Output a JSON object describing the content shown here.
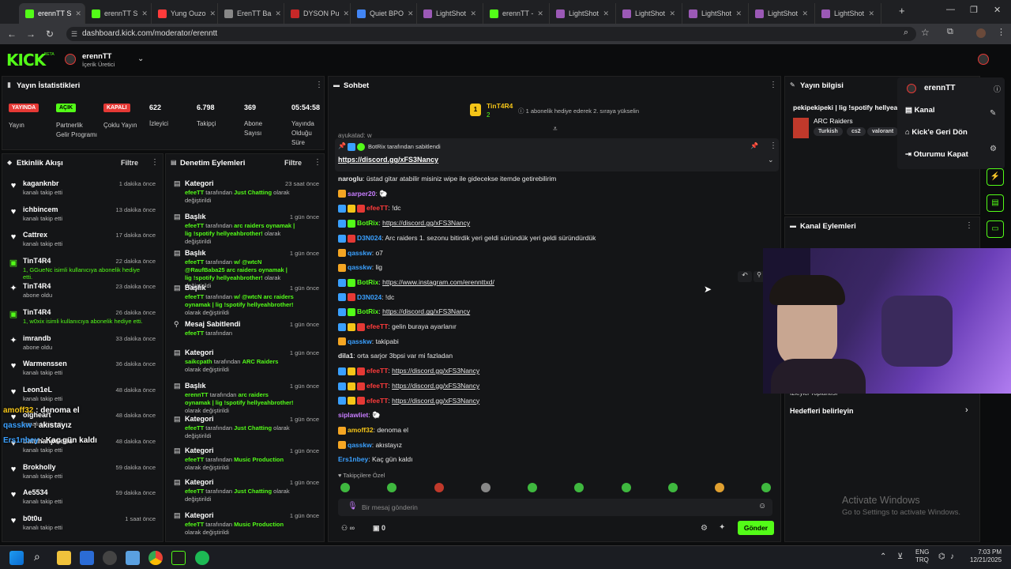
{
  "tabs": [
    {
      "label": "erennTT S",
      "color": "#53fc18",
      "active": true
    },
    {
      "label": "erennTT S",
      "color": "#53fc18"
    },
    {
      "label": "Yung Ouzo",
      "color": "#ff3b3b"
    },
    {
      "label": "ErenTT Ba",
      "color": "#888"
    },
    {
      "label": "DYSON Pu",
      "color": "#c62828"
    },
    {
      "label": "Quiet BPO",
      "color": "#4285f4"
    },
    {
      "label": "LightShot",
      "color": "#9b59b6"
    },
    {
      "label": "erennTT -",
      "color": "#53fc18"
    },
    {
      "label": "LightShot",
      "color": "#9b59b6"
    },
    {
      "label": "LightShot",
      "color": "#9b59b6"
    },
    {
      "label": "LightShot",
      "color": "#9b59b6"
    },
    {
      "label": "LightShot",
      "color": "#9b59b6"
    },
    {
      "label": "LightShot",
      "color": "#9b59b6"
    }
  ],
  "browser": {
    "url": "dashboard.kick.com/moderator/erenntt",
    "new_tab": "+"
  },
  "header": {
    "logo": "KICK",
    "beta": "BETA",
    "channel": "erennTT",
    "role": "İçerik Üretici"
  },
  "stats": {
    "title": "Yayın İstatistikleri",
    "badges": [
      {
        "text": "YAYINDA",
        "label": "Yayın",
        "color": "#e53935",
        "fg": "#fff"
      },
      {
        "text": "AÇIK",
        "label": "Partnerlik Gelir Programı",
        "color": "#53fc18",
        "fg": "#000"
      },
      {
        "text": "KAPALI",
        "label": "Çoklu Yayın",
        "color": "#e53935",
        "fg": "#fff"
      }
    ],
    "numbers": [
      {
        "value": "622",
        "label": "İzleyici"
      },
      {
        "value": "6.798",
        "label": "Takipçi"
      },
      {
        "value": "369",
        "label": "Abone Sayısı"
      },
      {
        "value": "05:54:58",
        "label": "Yayında Olduğu Süre"
      }
    ]
  },
  "activity": {
    "title": "Etkinlik Akışı",
    "filter": "Filtre",
    "items": [
      {
        "icon": "heart",
        "name": "kaganknbr",
        "sub": "kanalı takip etti",
        "time": "1 dakika önce"
      },
      {
        "icon": "heart",
        "name": "ichbincem",
        "sub": "kanalı takip etti",
        "time": "13 dakika önce"
      },
      {
        "icon": "heart",
        "name": "Cattrex",
        "sub": "kanalı takip etti",
        "time": "17 dakika önce"
      },
      {
        "icon": "gift",
        "name": "TinT4R4",
        "sub": "1, GGueNc isimli kullanıcıya abonelik hediye etti.",
        "time": "22 dakika önce"
      },
      {
        "icon": "star",
        "name": "TinT4R4",
        "sub": "abone oldu",
        "time": "23 dakika önce"
      },
      {
        "icon": "gift",
        "name": "TinT4R4",
        "sub": "1, w0xix isimli kullanıcıya abonelik hediye etti.",
        "time": "26 dakika önce"
      },
      {
        "icon": "star",
        "name": "imrandb",
        "sub": "abone oldu",
        "time": "33 dakika önce"
      },
      {
        "icon": "heart",
        "name": "Warmenssen",
        "sub": "kanalı takip etti",
        "time": "36 dakika önce"
      },
      {
        "icon": "heart",
        "name": "Leon1eL",
        "sub": "kanalı takip etti",
        "time": "48 dakika önce"
      },
      {
        "icon": "heart",
        "name": "olgheart",
        "sub": "kanalı takip etti",
        "time": "48 dakika önce"
      },
      {
        "icon": "heart",
        "name": "batuhanpekkis",
        "sub": "kanalı takip etti",
        "time": "48 dakika önce"
      },
      {
        "icon": "heart",
        "name": "Brokholly",
        "sub": "kanalı takip etti",
        "time": "59 dakika önce"
      },
      {
        "icon": "heart",
        "name": "Ae5534",
        "sub": "kanalı takip etti",
        "time": "59 dakika önce"
      },
      {
        "icon": "heart",
        "name": "b0t0u",
        "sub": "kanalı takip etti",
        "time": "1 saat önce"
      }
    ]
  },
  "overlay_chat": [
    {
      "user": "amoff32",
      "text": "denoma el",
      "color": "#f5c518"
    },
    {
      "user": "qasskw",
      "text": "akıstayız",
      "color": "#3aa0ff"
    },
    {
      "user": "Ers1nbey",
      "text": "Kaç gün kaldı",
      "color": "#3aa0ff"
    }
  ],
  "moderation": {
    "title": "Denetim Eylemleri",
    "filter": "Filtre",
    "items": [
      {
        "icon": "doc",
        "title": "Kategori",
        "time": "23 saat önce",
        "actor": "efeeTT",
        "mid": " tarafından ",
        "hl": "Just Chatting",
        "end": " olarak değiştirildi"
      },
      {
        "icon": "doc",
        "title": "Başlık",
        "time": "1 gün önce",
        "actor": "efeeTT",
        "mid": " tarafından ",
        "hl": "arc raiders oynamak | lig !spotify hellyeahbrother!",
        "end": " olarak değiştirildi"
      },
      {
        "icon": "doc",
        "title": "Başlık",
        "time": "1 gün önce",
        "actor": "efeeTT",
        "mid": " tarafından ",
        "hl": "w/ @wtcN @RaufBaba25 arc raiders oynamak | lig !spotify hellyeahbrother!",
        "end": " olarak değiştirildi"
      },
      {
        "icon": "doc",
        "title": "Başlık",
        "time": "1 gün önce",
        "actor": "efeeTT",
        "mid": " tarafından ",
        "hl": "w/ @wtcN arc raiders oynamak | lig !spotify hellyeahbrother!",
        "end": " olarak değiştirildi"
      },
      {
        "icon": "pin",
        "title": "Mesaj Sabitlendi",
        "time": "1 gün önce",
        "actor": "efeeTT",
        "mid": " tarafından",
        "hl": "",
        "end": ""
      },
      {
        "icon": "doc",
        "title": "Kategori",
        "time": "1 gün önce",
        "actor": "saikcpath",
        "mid": " tarafından ",
        "hl": "ARC Raiders",
        "end": " olarak değiştirildi"
      },
      {
        "icon": "doc",
        "title": "Başlık",
        "time": "1 gün önce",
        "actor": "erennTT",
        "mid": " tarafından ",
        "hl": "arc raiders oynamak | lig !spotify hellyeahbrother!",
        "end": " olarak değiştirildi"
      },
      {
        "icon": "doc",
        "title": "Kategori",
        "time": "1 gün önce",
        "actor": "efeeTT",
        "mid": " tarafından ",
        "hl": "Just Chatting",
        "end": " olarak değiştirildi"
      },
      {
        "icon": "doc",
        "title": "Kategori",
        "time": "1 gün önce",
        "actor": "efeeTT",
        "mid": " tarafından ",
        "hl": "Music Production",
        "end": " olarak değiştirildi"
      },
      {
        "icon": "doc",
        "title": "Kategori",
        "time": "1 gün önce",
        "actor": "efeeTT",
        "mid": " tarafından ",
        "hl": "Just Chatting",
        "end": " olarak değiştirildi"
      },
      {
        "icon": "doc",
        "title": "Kategori",
        "time": "1 gün önce",
        "actor": "efeeTT",
        "mid": " tarafından ",
        "hl": "Music Production",
        "end": " olarak değiştirildi"
      }
    ]
  },
  "chat": {
    "title": "Sohbet",
    "top_user": "TinT4R4",
    "top_count": "2",
    "top_hint": "1 abonelik hediye ederek 2. sıraya yükselin",
    "partial_line": "ayukatad: w",
    "pinned_by": "BotRix tarafından sabitlendi",
    "pinned_link": "https://discord.gg/xFS3Nancy",
    "messages": [
      {
        "user": "naroglu",
        "color": "#e6e6e6",
        "b": "",
        "text": "üstad gitar atabilir misiniz wipe ile gidecekse itemde getirebilirim"
      },
      {
        "user": "sarper20",
        "color": "#c77dff",
        "b": "crown",
        "text": "🐑"
      },
      {
        "user": "efeeTT",
        "color": "#ff3b3b",
        "b": "mod",
        "text": "!dc"
      },
      {
        "user": "BotRix",
        "color": "#53fc18",
        "b": "bot",
        "text": "https://discord.gg/xFS3Nancy",
        "link": true
      },
      {
        "user": "D3N024",
        "color": "#3aa0ff",
        "b": "mod2",
        "text": "Arc raiders 1. sezonu bitirdik yeri geldi süründük yeri geldi süründürdük"
      },
      {
        "user": "qasskw",
        "color": "#3aa0ff",
        "b": "crown",
        "text": "o7"
      },
      {
        "user": "qasskw",
        "color": "#3aa0ff",
        "b": "crown",
        "text": "lig"
      },
      {
        "user": "BotRix",
        "color": "#53fc18",
        "b": "bot",
        "text": "https://www.instagram.com/erennttxd/",
        "link": true
      },
      {
        "user": "D3N024",
        "color": "#3aa0ff",
        "b": "mod2",
        "text": "!dc"
      },
      {
        "user": "BotRix",
        "color": "#53fc18",
        "b": "bot",
        "text": "https://discord.gg/xFS3Nancy",
        "link": true
      },
      {
        "user": "efeeTT",
        "color": "#ff3b3b",
        "b": "mod",
        "text": "gelin buraya ayarlanır"
      },
      {
        "user": "qasskw",
        "color": "#3aa0ff",
        "b": "crown",
        "text": "takipabi"
      },
      {
        "user": "dila1",
        "color": "#e6e6e6",
        "b": "",
        "text": "orta sarjor 3bpsi var mi fazladan"
      },
      {
        "user": "efeeTT",
        "color": "#ff3b3b",
        "b": "mod",
        "text": "https://discord.gg/xFS3Nancy",
        "link": true
      },
      {
        "user": "efeeTT",
        "color": "#ff3b3b",
        "b": "mod",
        "text": "https://discord.gg/xFS3Nancy",
        "link": true
      },
      {
        "user": "efeeTT",
        "color": "#ff3b3b",
        "b": "mod",
        "text": "https://discord.gg/xFS3Nancy",
        "link": true
      },
      {
        "user": "siplawliet",
        "color": "#c77dff",
        "b": "",
        "text": "🐑"
      },
      {
        "user": "amoff32",
        "color": "#f5c518",
        "b": "crown",
        "text": "denoma el"
      },
      {
        "user": "qasskw",
        "color": "#3aa0ff",
        "b": "crown",
        "text": "akıstayız"
      },
      {
        "user": "Ers1nbey",
        "color": "#3aa0ff",
        "b": "",
        "text": "Kaç gün kaldı"
      }
    ],
    "followers_only": "Takipçilere Özel",
    "input_placeholder": "Bir mesaj gönderin",
    "points": "∞",
    "gifts": "0",
    "send": "Gönder"
  },
  "streaminfo": {
    "title": "Yayın bilgisi",
    "stream_title": "pekipekipeki | lig !spotify hellyea",
    "category": "ARC Raiders",
    "tags": [
      "Turkish",
      "cs2",
      "valorant"
    ]
  },
  "menu": {
    "user": "erennTT",
    "items": [
      "Kanal",
      "Kick'e Geri Dön",
      "Oturumu Kapat"
    ]
  },
  "channel_actions": {
    "title": "Kanal Eylemleri",
    "partial": "İzleyici Toplantısı",
    "goals": "Hedefleri belirleyin"
  },
  "windows": {
    "activate_title": "Activate Windows",
    "activate_sub": "Go to Settings to activate Windows.",
    "lang1": "ENG",
    "lang2": "TRQ",
    "time": "7:03 PM",
    "date": "12/21/2025"
  }
}
